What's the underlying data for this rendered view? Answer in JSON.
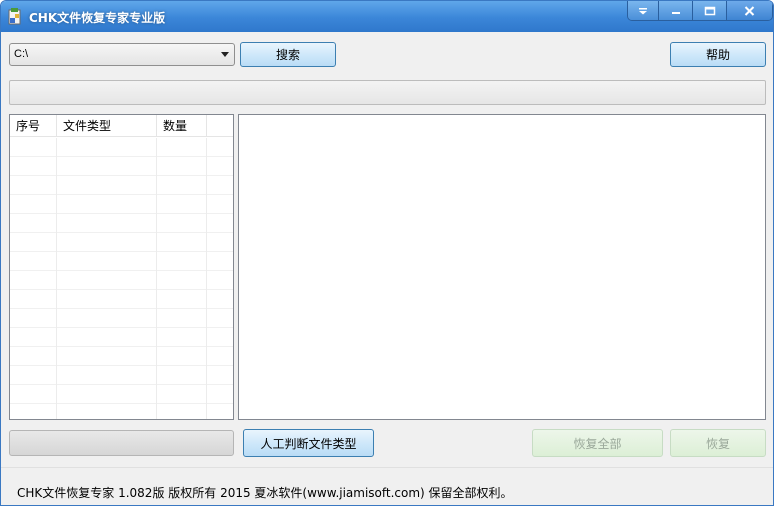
{
  "window": {
    "title": "CHK文件恢复专家专业版",
    "controls": {
      "menu_icon": "dropdown-arrow-icon",
      "minimize_icon": "minimize-icon",
      "maximize_icon": "maximize-icon",
      "close_icon": "close-icon"
    }
  },
  "toolbar": {
    "drive_select_value": "C:\\",
    "search_label": "搜索",
    "help_label": "帮助"
  },
  "file_list": {
    "columns": [
      "序号",
      "文件类型",
      "数量"
    ],
    "rows": []
  },
  "preview": {
    "content": ""
  },
  "actions": {
    "manual_detect_label": "人工判断文件类型",
    "recover_all_label": "恢复全部",
    "recover_label": "恢复"
  },
  "status": {
    "text": "CHK文件恢复专家 1.082版  版权所有 2015 夏冰软件(www.jiamisoft.com) 保留全部权利。"
  },
  "colors": {
    "titlebar": "#3b86d8",
    "button_blue": "#cfe8fa",
    "button_disabled": "#dcefd6"
  }
}
